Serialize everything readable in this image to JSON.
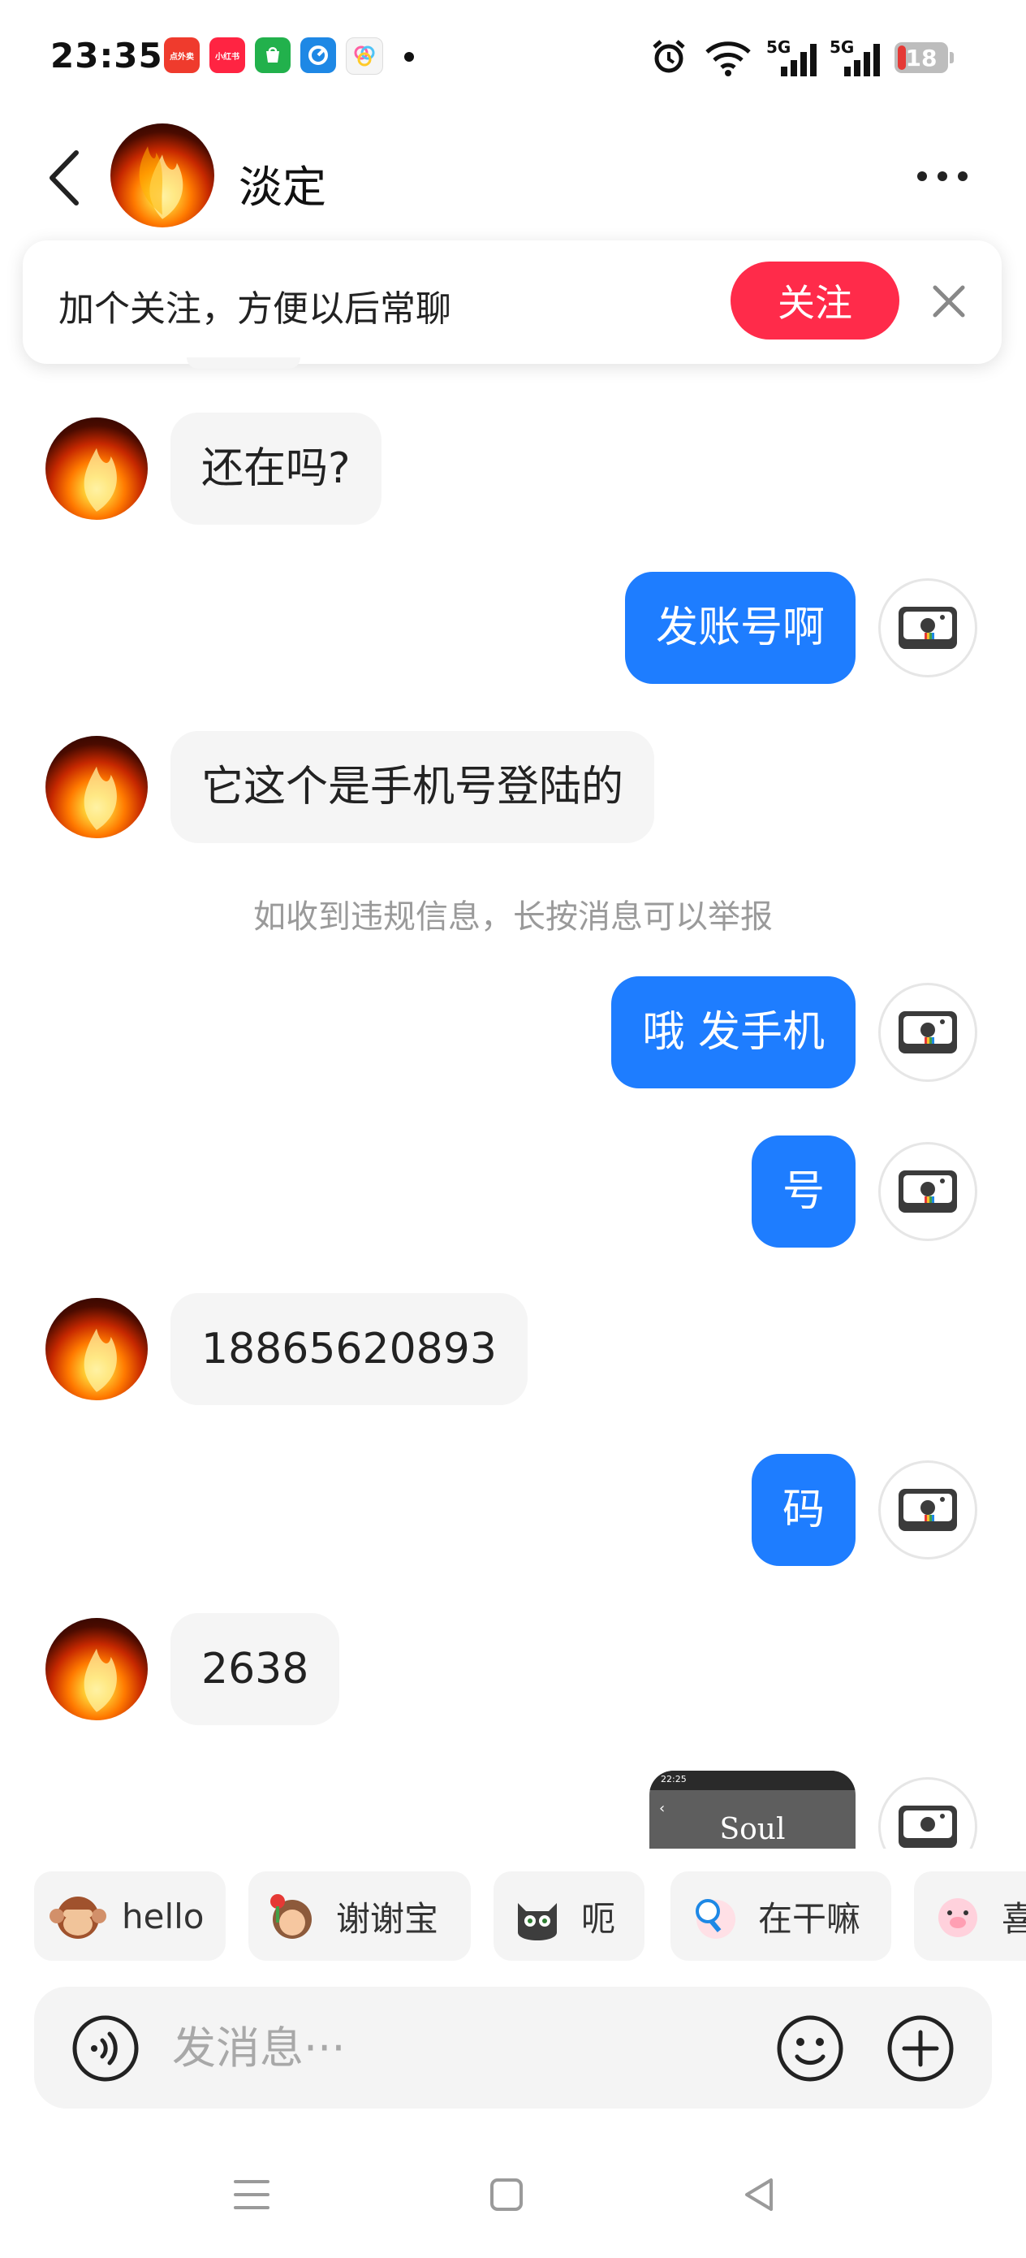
{
  "status_bar": {
    "time": "23:35",
    "app_icons": [
      {
        "name": "meituan-waimai-icon",
        "label": "点外卖",
        "color": "#ef3b2d"
      },
      {
        "name": "xiaohongshu-icon",
        "label": "小红书",
        "color": "#ff2442"
      },
      {
        "name": "green-shopping-app-icon",
        "label": "",
        "color": "#22b14c"
      },
      {
        "name": "blue-app-icon",
        "label": "",
        "color": "#1e88e5"
      },
      {
        "name": "multicolor-app-icon",
        "label": "",
        "color": "#f5f5f5"
      }
    ],
    "network_1": "5G",
    "network_2": "5G",
    "battery": "18"
  },
  "header": {
    "contact_name": "淡定"
  },
  "follow_banner": {
    "text": "加个关注，方便以后常聊",
    "button_label": "关注"
  },
  "messages": [
    {
      "direction": "in",
      "text": "还在吗?"
    },
    {
      "direction": "out",
      "text": "发账号啊"
    },
    {
      "direction": "in",
      "text": "它这个是手机号登陆的"
    },
    {
      "direction": "out",
      "text": "哦  发手机"
    },
    {
      "direction": "out",
      "text": "号"
    },
    {
      "direction": "in",
      "text": "18865620893"
    },
    {
      "direction": "out",
      "text": "码"
    },
    {
      "direction": "in",
      "text": "2638"
    }
  ],
  "screenshot_preview": {
    "mini_time": "22:25",
    "label": "Soul"
  },
  "system_notice": "如收到违规信息，长按消息可以举报",
  "quick_replies": [
    {
      "label": "hello",
      "emoji": "monkey"
    },
    {
      "label": "谢谢宝",
      "emoji": "girl-with-flower"
    },
    {
      "label": "呃",
      "emoji": "cat"
    },
    {
      "label": "在干嘛",
      "emoji": "magnifier-character"
    },
    {
      "label": "喜",
      "emoji": "pig"
    }
  ],
  "input": {
    "placeholder": "发消息···"
  },
  "colors": {
    "accent_blue": "#1e7dff",
    "follow_red": "#ff2b4a",
    "incoming_bubble": "#f5f5f5"
  }
}
